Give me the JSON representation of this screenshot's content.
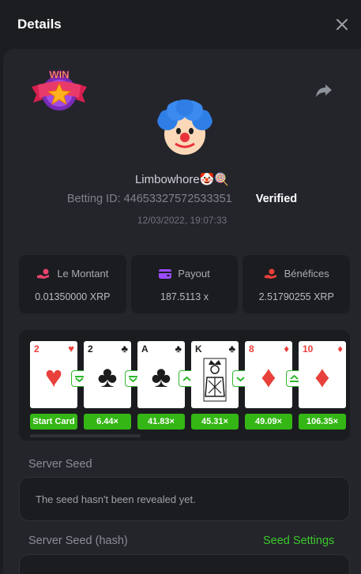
{
  "header": {
    "title": "Details",
    "close_icon": "close-icon"
  },
  "profile": {
    "badge_text": "WIN",
    "username": "Limbowhore🤡🍭",
    "betting_id_label": "Betting ID:",
    "betting_id": "44653327572533351",
    "verified": "Verified",
    "datetime": "12/03/2022, 19:07:33"
  },
  "stats": [
    {
      "label": "Le Montant",
      "value": "0.01350000 XRP",
      "icon": "coins-hand-icon",
      "color": "#e8436e"
    },
    {
      "label": "Payout",
      "value": "187.5113 x",
      "icon": "wallet-icon",
      "color": "#9b4dff"
    },
    {
      "label": "Bénéfices",
      "value": "2.51790255 XRP",
      "icon": "coins-hand-icon",
      "color": "#e8403a"
    }
  ],
  "cards": [
    {
      "rank": "2",
      "suit": "♥",
      "color": "red",
      "pill": "Start Card"
    },
    {
      "rank": "2",
      "suit": "♣",
      "color": "blk",
      "pill": "6.44×",
      "arrow": "down"
    },
    {
      "rank": "A",
      "suit": "♣",
      "color": "blk",
      "pill": "41.83×",
      "arrow": "down"
    },
    {
      "rank": "K",
      "suit": "♣",
      "color": "blk",
      "pill": "45.31×",
      "arrow": "up"
    },
    {
      "rank": "8",
      "suit": "♦",
      "color": "red",
      "pill": "49.09×",
      "arrow": "down"
    },
    {
      "rank": "10",
      "suit": "♦",
      "color": "red",
      "pill": "106.35×",
      "arrow": "up-double"
    }
  ],
  "server_seed": {
    "label": "Server Seed",
    "value": "The seed hasn't been revealed yet.",
    "hash_label": "Server Seed (hash)",
    "settings_link": "Seed Settings"
  },
  "colors": {
    "accent_green": "#34b615",
    "panel": "#1b1c20",
    "background": "#24252b"
  }
}
